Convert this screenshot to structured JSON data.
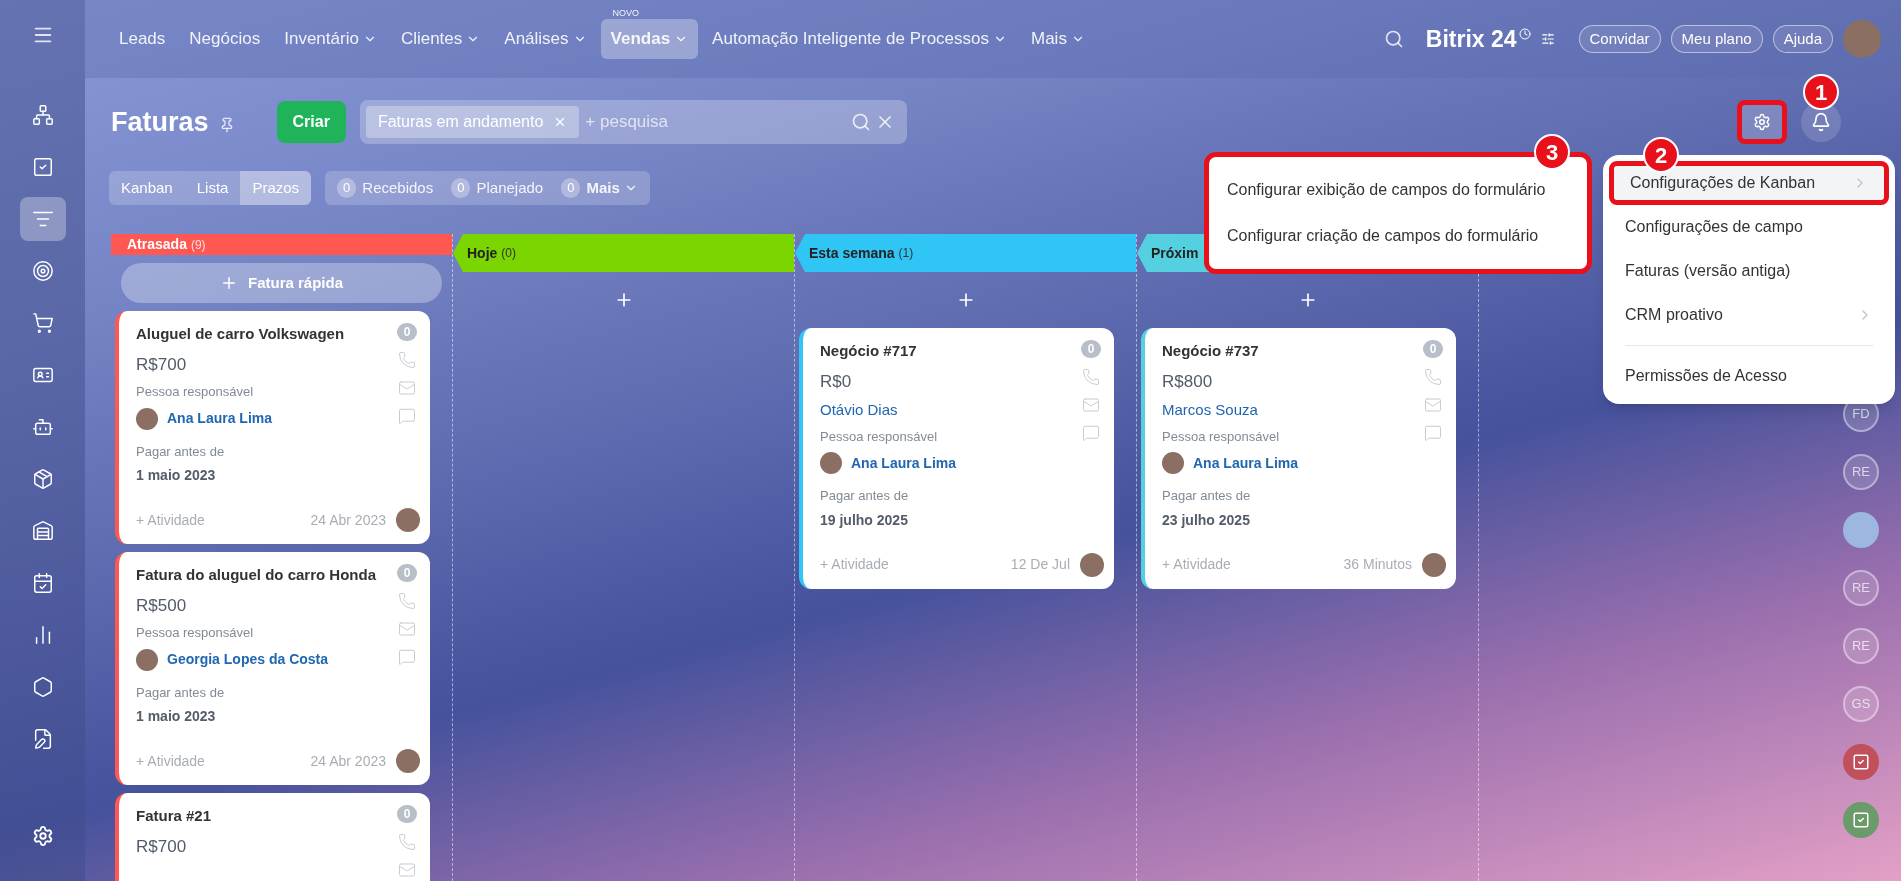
{
  "sidebar": {
    "items": [
      {
        "selected": false
      },
      {
        "selected": false
      },
      {
        "selected": true
      },
      {
        "selected": false
      },
      {
        "selected": false
      },
      {
        "selected": false
      },
      {
        "selected": false
      },
      {
        "selected": false
      },
      {
        "selected": false
      },
      {
        "selected": false
      },
      {
        "selected": false
      },
      {
        "selected": false
      },
      {
        "selected": false
      }
    ]
  },
  "nav": {
    "items": [
      {
        "label": "Leads",
        "dropdown": false,
        "selected": false
      },
      {
        "label": "Negócios",
        "dropdown": false,
        "selected": false
      },
      {
        "label": "Inventário",
        "dropdown": true,
        "selected": false
      },
      {
        "label": "Clientes",
        "dropdown": true,
        "selected": false
      },
      {
        "label": "Análises",
        "dropdown": true,
        "selected": false
      },
      {
        "label": "Vendas",
        "dropdown": true,
        "selected": true,
        "badge": "NOVO"
      },
      {
        "label": "Automação Inteligente de Processos",
        "dropdown": true,
        "selected": false
      },
      {
        "label": "Mais",
        "dropdown": true,
        "selected": false
      }
    ],
    "logo": "Bitrix 24",
    "buttons": [
      "Convidar",
      "Meu plano",
      "Ajuda"
    ]
  },
  "header": {
    "title": "Faturas",
    "create": "Criar",
    "filter_chip": "Faturas em andamento",
    "search_placeholder": "+ pesquisa",
    "settings_highlighted": true
  },
  "view_tabs": [
    {
      "label": "Kanban",
      "selected": false
    },
    {
      "label": "Lista",
      "selected": false
    },
    {
      "label": "Prazos",
      "selected": true
    }
  ],
  "counters": [
    {
      "count": "0",
      "label": "Recebidos",
      "dropdown": false
    },
    {
      "count": "0",
      "label": "Planejado",
      "dropdown": false
    },
    {
      "count": "0",
      "label": "Mais",
      "dropdown": true
    }
  ],
  "columns": [
    {
      "title": "Atrasada",
      "count": "(9)",
      "color": "#ff5752",
      "add_label": "Fatura rápida",
      "cards": [
        {
          "title": "Aluguel de carro Volkswagen",
          "badge": "0",
          "amount": "R$700",
          "responsible_label": "Pessoa responsável",
          "responsible": "Ana Laura Lima",
          "due_label": "Pagar antes de",
          "due": "1 maio 2023",
          "activity": "+ Atividade",
          "date": "24 Abr 2023"
        },
        {
          "title": "Fatura do aluguel do carro Honda",
          "badge": "0",
          "amount": "R$500",
          "responsible_label": "Pessoa responsável",
          "responsible": "Georgia Lopes da Costa",
          "due_label": "Pagar antes de",
          "due": "1 maio 2023",
          "activity": "+ Atividade",
          "date": "24 Abr 2023"
        },
        {
          "title": "Fatura #21",
          "badge": "0",
          "amount": "R$700"
        }
      ]
    },
    {
      "title": "Hoje",
      "count": "(0)",
      "color": "#7bd500"
    },
    {
      "title": "Esta semana",
      "count": "(1)",
      "color": "#2fc6f6",
      "cards": [
        {
          "title": "Negócio #717",
          "badge": "0",
          "amount": "R$0",
          "contact": "Otávio Dias",
          "responsible_label": "Pessoa responsável",
          "responsible": "Ana Laura Lima",
          "due_label": "Pagar antes de",
          "due": "19 julho 2025",
          "activity": "+ Atividade",
          "date": "12 De Jul"
        }
      ]
    },
    {
      "title": "Próxim",
      "color": "#55d0e0",
      "cards": [
        {
          "title": "Negócio #737",
          "badge": "0",
          "amount": "R$800",
          "contact": "Marcos Souza",
          "responsible_label": "Pessoa responsável",
          "responsible": "Ana Laura Lima",
          "due_label": "Pagar antes de",
          "due": "23 julho 2025",
          "activity": "+ Atividade",
          "date": "36 Minutos"
        }
      ]
    }
  ],
  "settings_menu": {
    "items": [
      {
        "label": "Configurações de Kanban",
        "submenu": true,
        "highlighted": true
      },
      {
        "label": "Configurações de campo",
        "submenu": false,
        "highlighted": false
      },
      {
        "label": "Faturas (versão antiga)",
        "submenu": false,
        "highlighted": false
      },
      {
        "label": "CRM proativo",
        "submenu": true,
        "highlighted": false
      },
      {
        "label": "Permissões de Acesso",
        "submenu": false,
        "highlighted": false
      }
    ]
  },
  "submenu": {
    "highlighted": true,
    "items": [
      "Configurar exibição de campos do formulário",
      "Configurar criação de campos do formulário"
    ]
  },
  "callouts": [
    "1",
    "2",
    "3"
  ],
  "right_panel": [
    {
      "kind": "initials",
      "text": "FD"
    },
    {
      "kind": "initials",
      "text": "RE"
    },
    {
      "kind": "photo"
    },
    {
      "kind": "initials",
      "text": "RE"
    },
    {
      "kind": "initials",
      "text": "RE"
    },
    {
      "kind": "initials",
      "text": "GS"
    },
    {
      "kind": "task",
      "color": "#c0505a"
    },
    {
      "kind": "task",
      "color": "#6b9a6b"
    }
  ]
}
